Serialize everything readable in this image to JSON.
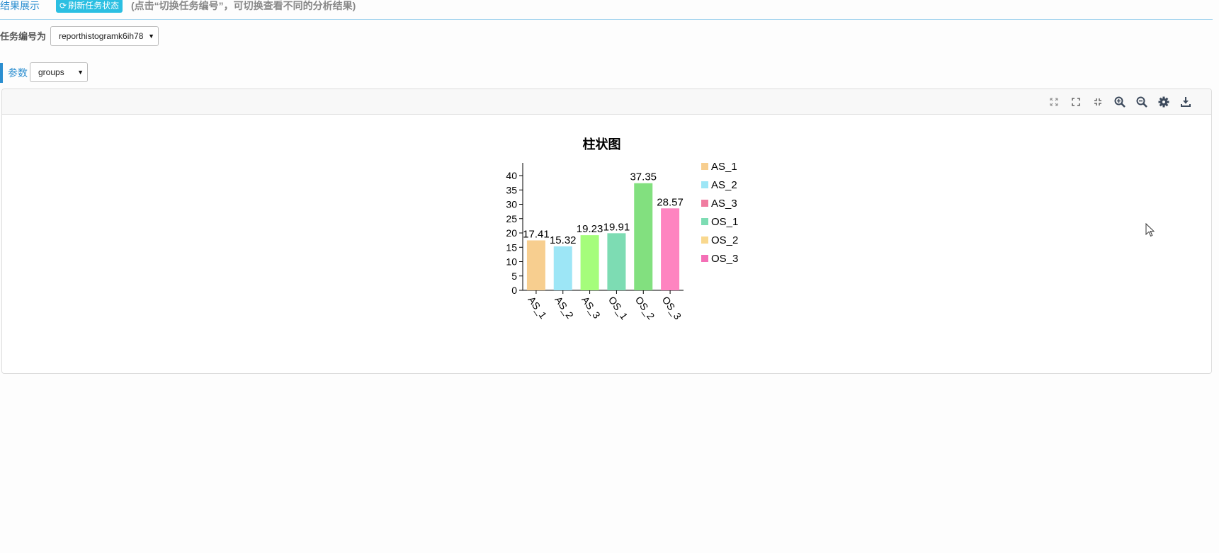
{
  "header": {
    "tab_title": "结果展示",
    "refresh_label": "刷新任务状态",
    "hint": "(点击“切换任务编号”，可切换查看不同的分析结果)"
  },
  "task": {
    "label": "任务编号为",
    "selected": "reporthistogramk6ih78"
  },
  "params": {
    "label": "参数",
    "selected": "groups"
  },
  "toolbar": {
    "icons": [
      "expand-arrows-icon",
      "fullscreen-icon",
      "compress-icon",
      "zoom-in-icon",
      "zoom-out-icon",
      "gear-icon",
      "download-icon"
    ]
  },
  "chart_data": {
    "type": "bar",
    "title": "柱状图",
    "xlabel": "",
    "ylabel": "",
    "categories": [
      "AS_1",
      "AS_2",
      "AS_3",
      "OS_1",
      "OS_2",
      "OS_3"
    ],
    "values": [
      17.41,
      15.32,
      19.23,
      19.91,
      37.35,
      28.57
    ],
    "value_labels": [
      "17.41",
      "15.32",
      "19.23",
      "19.91",
      "37.35",
      "28.57"
    ],
    "colors": [
      "#f7ce8f",
      "#9de6f6",
      "#a5fd7b",
      "#7ddcb3",
      "#82e07f",
      "#fe84c0"
    ],
    "legend_colors": [
      "#f7ce8f",
      "#9de6f6",
      "#f07ca0",
      "#7ddcb3",
      "#f9d88e",
      "#f46fb6"
    ],
    "ylim": [
      0,
      44
    ],
    "yticks": [
      0,
      5,
      10,
      15,
      20,
      25,
      30,
      35,
      40
    ],
    "legend": "right",
    "grid": false
  }
}
